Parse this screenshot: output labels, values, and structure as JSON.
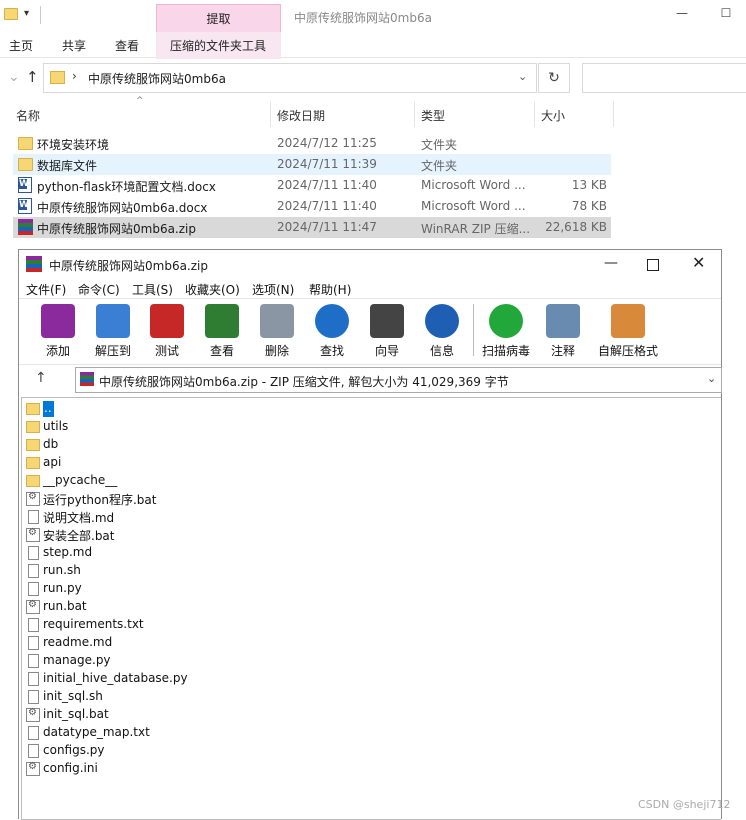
{
  "explorer": {
    "title": "中原传统服饰网站0mb6a",
    "ribbon_context_tab": "提取",
    "ribbon_tabs": [
      "主页",
      "共享",
      "查看",
      "压缩的文件夹工具"
    ],
    "address": "中原传统服饰网站0mb6a",
    "columns": {
      "name": "名称",
      "date": "修改日期",
      "type": "类型",
      "size": "大小"
    },
    "files": [
      {
        "name": "环境安装环境",
        "date": "2024/7/12 11:25",
        "type": "文件夹",
        "size": "",
        "icon": "folder-icon"
      },
      {
        "name": "数据库文件",
        "date": "2024/7/11 11:39",
        "type": "文件夹",
        "size": "",
        "icon": "folder-icon"
      },
      {
        "name": "python-flask环境配置文档.docx",
        "date": "2024/7/11 11:40",
        "type": "Microsoft Word ...",
        "size": "13 KB",
        "icon": "word-icon"
      },
      {
        "name": "中原传统服饰网站0mb6a.docx",
        "date": "2024/7/11 11:40",
        "type": "Microsoft Word ...",
        "size": "78 KB",
        "icon": "word-icon"
      },
      {
        "name": "中原传统服饰网站0mb6a.zip",
        "date": "2024/7/11 11:47",
        "type": "WinRAR ZIP 压缩...",
        "size": "22,618 KB",
        "icon": "winrar-icon"
      }
    ],
    "hover_row": 1,
    "selected_row": 4
  },
  "winrar": {
    "title": "中原传统服饰网站0mb6a.zip",
    "menu": [
      "文件(F)",
      "命令(C)",
      "工具(S)",
      "收藏夹(O)",
      "选项(N)",
      "帮助(H)"
    ],
    "toolbar": [
      {
        "label": "添加",
        "icon": "add-archive-icon",
        "color": "#8b2a9c"
      },
      {
        "label": "解压到",
        "icon": "extract-to-icon",
        "color": "#3b7fd4"
      },
      {
        "label": "测试",
        "icon": "test-icon",
        "color": "#c62828"
      },
      {
        "label": "查看",
        "icon": "view-book-icon",
        "color": "#2e7d32"
      },
      {
        "label": "删除",
        "icon": "trash-icon",
        "color": "#8a96a3"
      },
      {
        "label": "查找",
        "icon": "magnifier-icon",
        "color": "#1e6ec8"
      },
      {
        "label": "向导",
        "icon": "wizard-wand-icon",
        "color": "#444444"
      },
      {
        "label": "信息",
        "icon": "info-icon",
        "color": "#1e5fb4"
      },
      {
        "label": "扫描病毒",
        "icon": "virus-scan-icon",
        "color": "#22a83a"
      },
      {
        "label": "注释",
        "icon": "comment-icon",
        "color": "#6a8bb0"
      },
      {
        "label": "自解压格式",
        "icon": "sfx-box-icon",
        "color": "#d88a3a"
      }
    ],
    "path": "中原传统服饰网站0mb6a.zip - ZIP 压缩文件, 解包大小为 41,029,369 字节",
    "entries": [
      {
        "name": "..",
        "kind": "up"
      },
      {
        "name": "utils",
        "kind": "folder"
      },
      {
        "name": "db",
        "kind": "folder"
      },
      {
        "name": "api",
        "kind": "folder"
      },
      {
        "name": "__pycache__",
        "kind": "folder"
      },
      {
        "name": "运行python程序.bat",
        "kind": "bat"
      },
      {
        "name": "说明文档.md",
        "kind": "file"
      },
      {
        "name": "安装全部.bat",
        "kind": "bat"
      },
      {
        "name": "step.md",
        "kind": "file"
      },
      {
        "name": "run.sh",
        "kind": "file"
      },
      {
        "name": "run.py",
        "kind": "file"
      },
      {
        "name": "run.bat",
        "kind": "bat"
      },
      {
        "name": "requirements.txt",
        "kind": "file"
      },
      {
        "name": "readme.md",
        "kind": "file"
      },
      {
        "name": "manage.py",
        "kind": "file"
      },
      {
        "name": "initial_hive_database.py",
        "kind": "file"
      },
      {
        "name": "init_sql.sh",
        "kind": "file"
      },
      {
        "name": "init_sql.bat",
        "kind": "bat"
      },
      {
        "name": "datatype_map.txt",
        "kind": "file"
      },
      {
        "name": "configs.py",
        "kind": "file"
      },
      {
        "name": "config.ini",
        "kind": "bat"
      }
    ]
  },
  "watermark": "CSDN @sheji712"
}
